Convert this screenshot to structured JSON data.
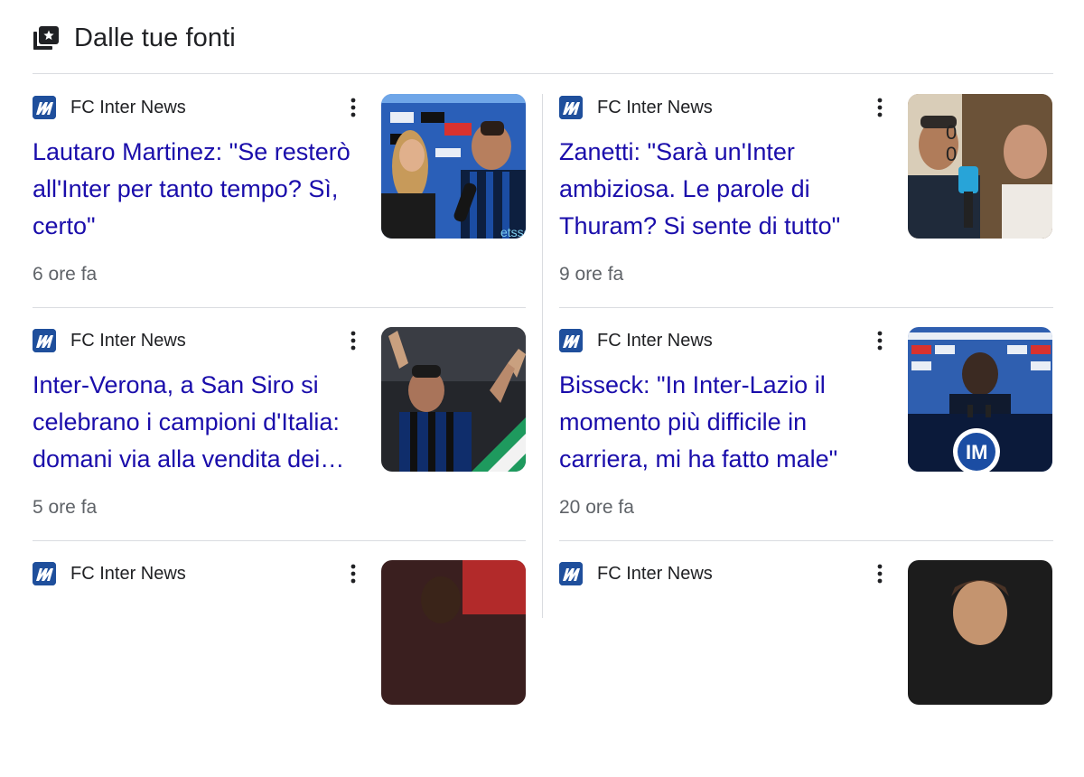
{
  "section": {
    "title": "Dalle tue fonti",
    "icon": "newspaper-star-icon"
  },
  "cards": [
    {
      "source": "FC Inter News",
      "title": "Lautaro Martinez: \"Se resterò all'Inter per tanto tempo? Sì, certo\"",
      "time": "6 ore fa",
      "thumb": "interview-photo"
    },
    {
      "source": "FC Inter News",
      "title": "Zanetti: \"Sarà un'Inter ambiziosa. Le parole di Thuram? Si sente di tutto\"",
      "time": "9 ore fa",
      "thumb": "interview-photo"
    },
    {
      "source": "FC Inter News",
      "title": "Inter-Verona, a San Siro si celebrano i campioni d'Italia: domani via alla vendita dei…",
      "time": "5 ore fa",
      "thumb": "celebration-photo"
    },
    {
      "source": "FC Inter News",
      "title": "Bisseck: \"In Inter-Lazio il momento più difficile in carriera, mi ha fatto male\"",
      "time": "20 ore fa",
      "thumb": "press-conference-photo"
    },
    {
      "source": "FC Inter News",
      "title": "",
      "thumb": "player-photo"
    },
    {
      "source": "FC Inter News",
      "title": "",
      "thumb": "player-photo"
    }
  ],
  "colors": {
    "link": "#1a0dab",
    "secondary_text": "#5f6368",
    "divider": "#dadce0",
    "source_logo": "#1f4f9c"
  }
}
